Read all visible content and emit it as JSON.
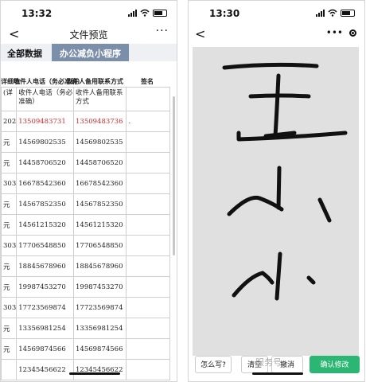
{
  "left": {
    "status": {
      "time": "13:32"
    },
    "nav": {
      "back": "<",
      "title": "文件预览",
      "more": "···"
    },
    "tabs": [
      "全部数据",
      "办公减负小程序"
    ],
    "sheet_header": {
      "c1": "详细地",
      "c2": "收件人电话（务必准确）",
      "c3": "收件人备用联系方式",
      "c4": "签名"
    },
    "columns": {
      "c0": "(详",
      "c1": "收件人电话（务必准确）",
      "c2": "收件人备用联系方式"
    },
    "rows": [
      {
        "c0": "202",
        "phone": "13509483731",
        "alt": "13509483736",
        "extra": ".",
        "red": true
      },
      {
        "c0": "元",
        "phone": "14569802535",
        "alt": "14569802535",
        "extra": ""
      },
      {
        "c0": "元",
        "phone": "14458706520",
        "alt": "14458706520",
        "extra": ""
      },
      {
        "c0": "303",
        "phone": "16678542360",
        "alt": "16678542360",
        "extra": ""
      },
      {
        "c0": "元",
        "phone": "14567852350",
        "alt": "14567852350",
        "extra": ""
      },
      {
        "c0": "元",
        "phone": "14561215320",
        "alt": "14561215320",
        "extra": ""
      },
      {
        "c0": "303",
        "phone": "17706548850",
        "alt": "17706548850",
        "extra": ""
      },
      {
        "c0": "元",
        "phone": "18845678960",
        "alt": "18845678960",
        "extra": ""
      },
      {
        "c0": "元",
        "phone": "19987453270",
        "alt": "19987453270",
        "extra": ""
      },
      {
        "c0": "303",
        "phone": "17723569874",
        "alt": "17723569874",
        "extra": ""
      },
      {
        "c0": "元",
        "phone": "13356981254",
        "alt": "13356981254",
        "extra": ""
      },
      {
        "c0": "元",
        "phone": "14569874566",
        "alt": "14569874566",
        "extra": ""
      },
      {
        "c0": "",
        "phone": "12345456622",
        "alt": "12345456622",
        "extra": ""
      }
    ]
  },
  "right": {
    "status": {
      "time": "13:30"
    },
    "nav": {
      "back": "<",
      "more": "•••"
    },
    "buttons": {
      "how": "怎么写?",
      "clear": "清空",
      "undo": "撤消",
      "submit": "确认修改"
    },
    "watermark": "服务号"
  },
  "colors": {
    "tab_active": "#7b8eaa",
    "red_text": "#d12a2a",
    "green_button": "#2bb673",
    "canvas_bg": "#e0e0e0"
  }
}
